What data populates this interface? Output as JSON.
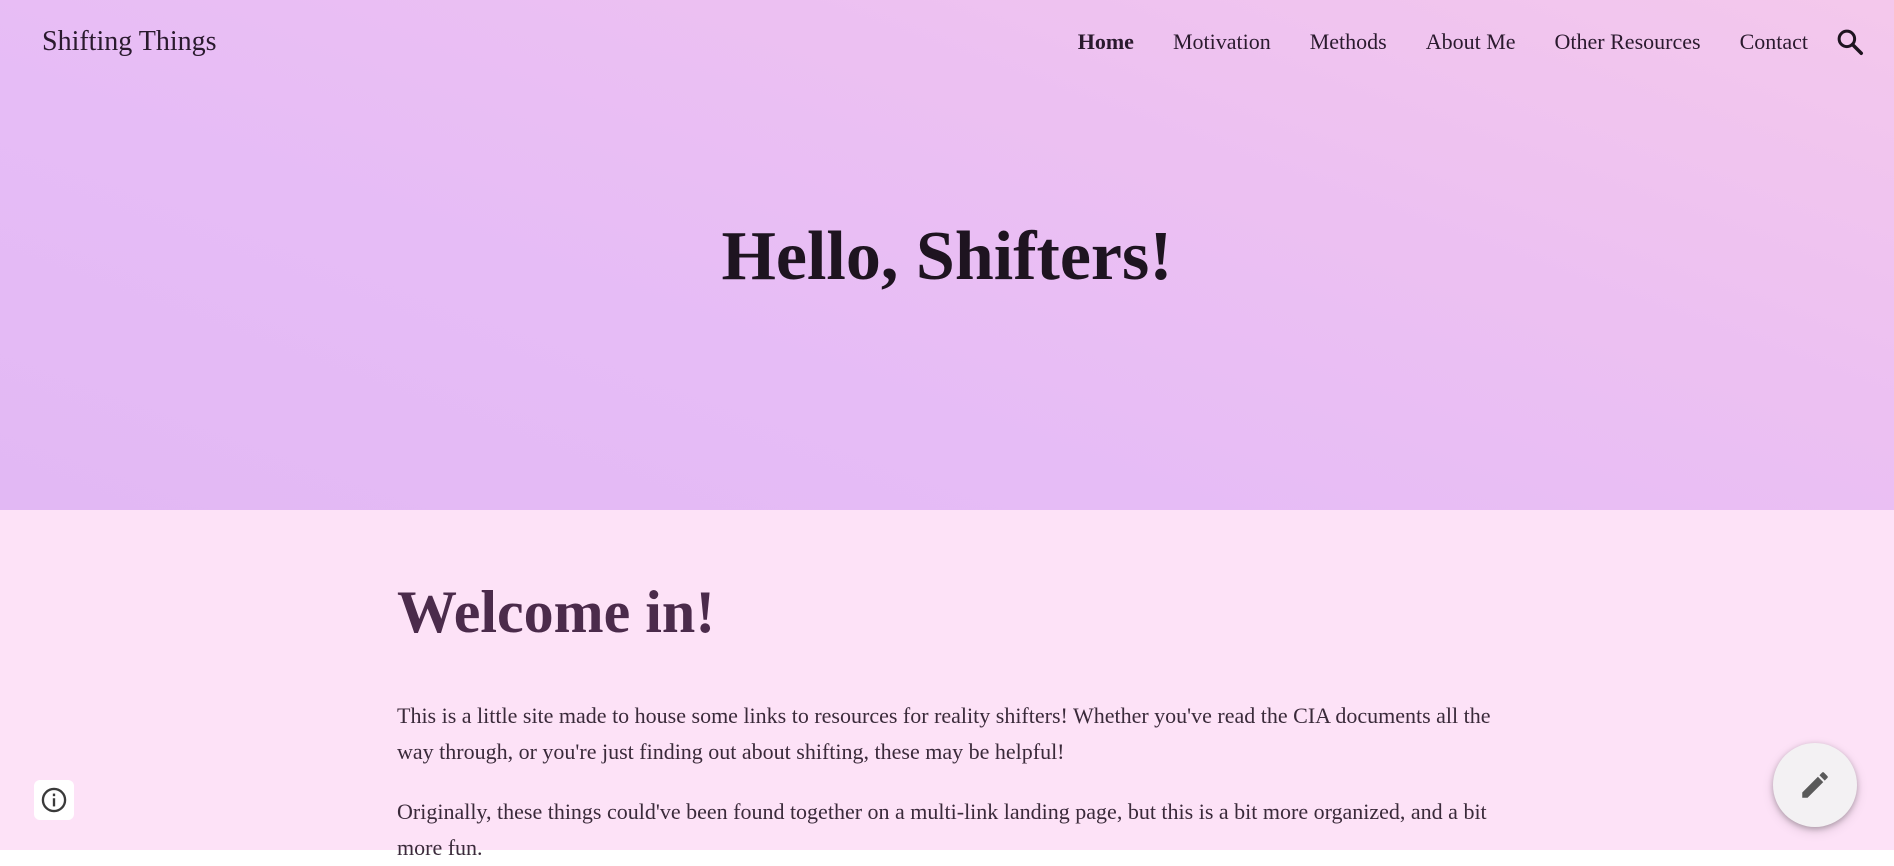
{
  "site": {
    "title": "Shifting Things"
  },
  "nav": {
    "items": [
      {
        "label": "Home",
        "active": true
      },
      {
        "label": "Motivation",
        "active": false
      },
      {
        "label": "Methods",
        "active": false
      },
      {
        "label": "About Me",
        "active": false
      },
      {
        "label": "Other Resources",
        "active": false
      },
      {
        "label": "Contact",
        "active": false
      }
    ],
    "search_icon": "search-icon"
  },
  "hero": {
    "title": "Hello, Shifters!"
  },
  "main": {
    "heading": "Welcome in!",
    "paragraphs": [
      "This is a little site made to house some links to resources for reality shifters! Whether you've read the CIA documents all the way through, or you're just finding out about shifting, these may be helpful!",
      "Originally, these things could've been found together on a multi-link landing page, but this is a bit more organized, and a bit more fun."
    ]
  },
  "widgets": {
    "info_icon": "info-icon",
    "edit_icon": "pencil-icon"
  },
  "colors": {
    "hero_gradient_start": "#f4c8ec",
    "hero_gradient_end": "#e2b8f4",
    "content_background": "#fde2f7",
    "heading_color": "#4b2b4b",
    "text_color": "#3a2a3a"
  }
}
